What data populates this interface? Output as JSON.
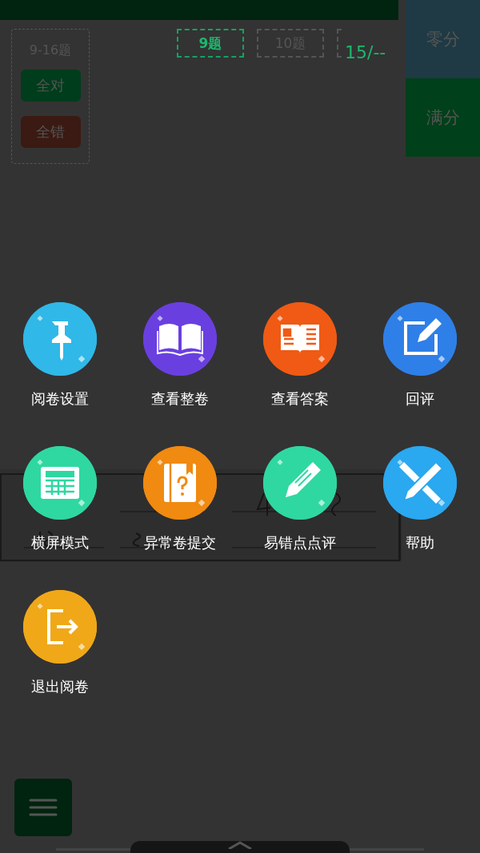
{
  "group_panel": {
    "range": "9-16题",
    "buttons": [
      {
        "label": "全对",
        "kind": "correct"
      },
      {
        "label": "全错",
        "kind": "wrong"
      }
    ]
  },
  "questions": [
    {
      "label": "9题",
      "selected": true
    },
    {
      "label": "10题",
      "selected": false
    },
    {
      "selected": false
    }
  ],
  "score": "15/--",
  "score_buttons": [
    {
      "label": "零分",
      "kind": "zero"
    },
    {
      "label": "满分",
      "kind": "full"
    }
  ],
  "menu_items": [
    {
      "label": "阅卷设置",
      "kind": "pin",
      "color": "#30b8e8"
    },
    {
      "label": "查看整卷",
      "kind": "book",
      "color": "#6a3fe0"
    },
    {
      "label": "查看答案",
      "kind": "answer",
      "color": "#f05a14"
    },
    {
      "label": "回评",
      "kind": "edit",
      "color": "#2f7fe8"
    },
    {
      "label": "横屏模式",
      "kind": "calc",
      "color": "#2fd8a0"
    },
    {
      "label": "异常卷提交",
      "kind": "notebook",
      "color": "#f08a10"
    },
    {
      "label": "易错点点评",
      "kind": "pencil",
      "color": "#2fd8a0"
    },
    {
      "label": "帮助",
      "kind": "tools",
      "color": "#2aa8f0"
    },
    {
      "label": "退出阅卷",
      "kind": "exit",
      "color": "#f0a818"
    }
  ]
}
